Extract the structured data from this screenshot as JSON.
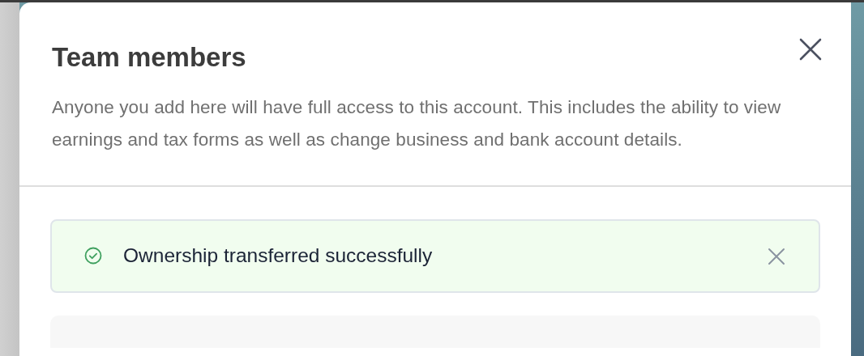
{
  "dialog": {
    "title": "Team members",
    "description": "Anyone you add here will have full access to this account. This includes the ability to view earnings and tax forms as well as change business and bank account details."
  },
  "alert": {
    "kind": "success",
    "message": "Ownership transferred successfully"
  }
}
